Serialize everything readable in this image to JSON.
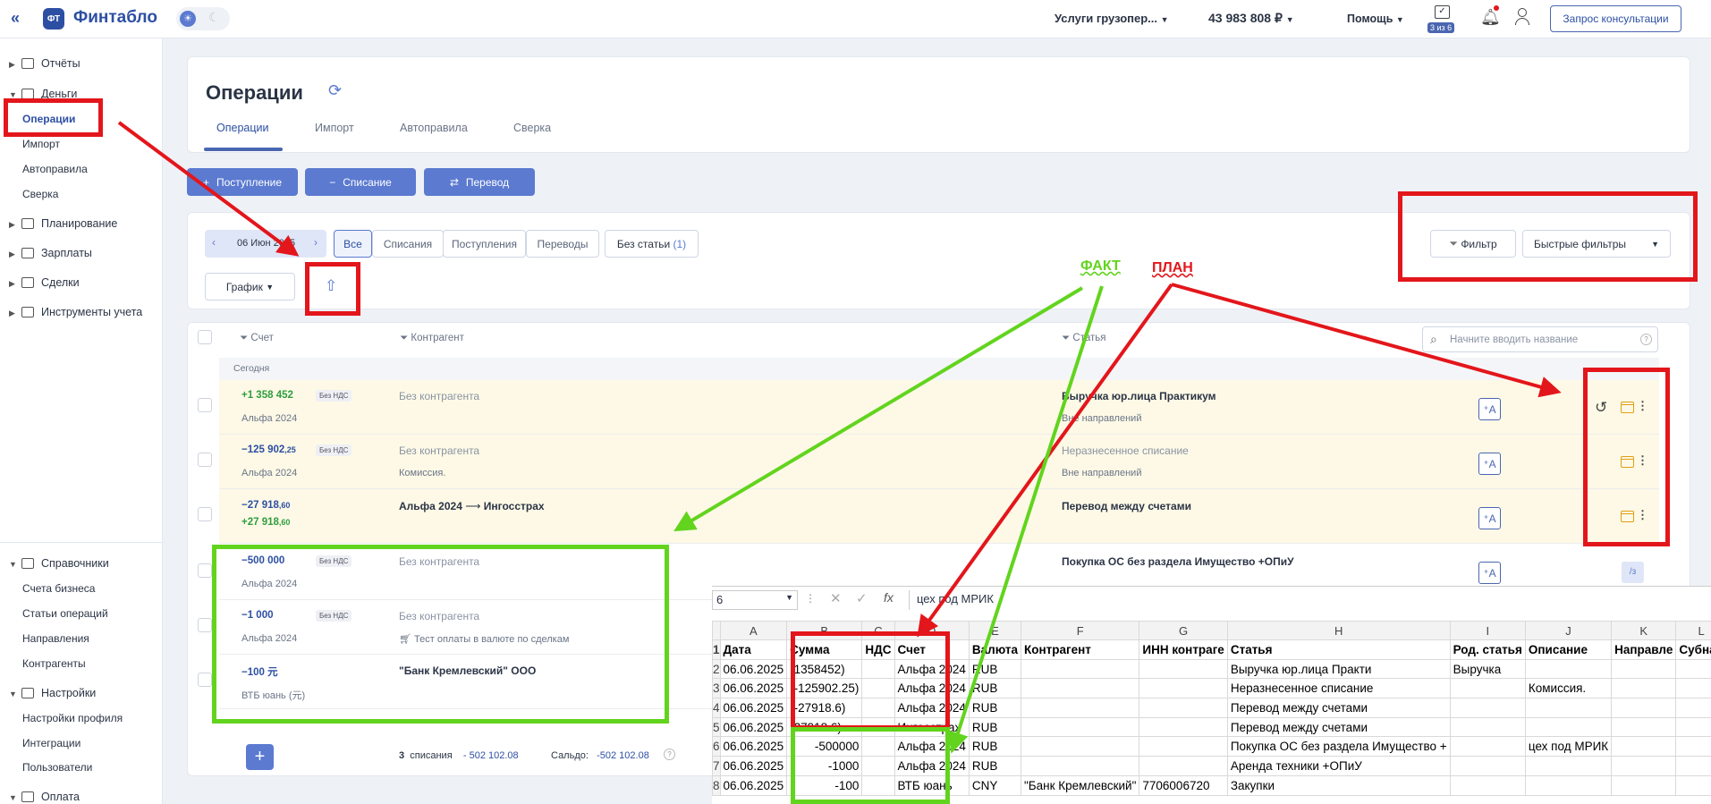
{
  "topbar": {
    "logo_badge": "ФТ",
    "logo_text": "Финтабло",
    "company": "Услуги грузопер...",
    "balance": "43 983 808 ₽",
    "help": "Помощь",
    "tasks_badge": "3 из 6",
    "consult_button": "Запрос консультации"
  },
  "sidebar": {
    "reports": "Отчёты",
    "money": "Деньги",
    "operations": "Операции",
    "import": "Импорт",
    "autorules": "Автоправила",
    "reconciliation": "Сверка",
    "planning": "Планирование",
    "salaries": "Зарплаты",
    "deals": "Сделки",
    "tools": "Инструменты учета",
    "references": "Справочники",
    "business_accounts": "Счета бизнеса",
    "operation_items": "Статьи операций",
    "directions": "Направления",
    "counterparties": "Контрагенты",
    "settings": "Настройки",
    "profile_settings": "Настройки профиля",
    "integrations": "Интеграции",
    "users": "Пользователи",
    "payment": "Оплата"
  },
  "page": {
    "title": "Операции",
    "tabs": [
      "Операции",
      "Импорт",
      "Автоправила",
      "Сверка"
    ]
  },
  "actions": {
    "income": "Поступление",
    "expense": "Списание",
    "transfer": "Перевод"
  },
  "filters": {
    "date": "06 Июн 2025",
    "all": "Все",
    "expenses": "Списания",
    "incomes": "Поступления",
    "transfers": "Переводы",
    "no_item": "Без статьи",
    "no_item_count": "(1)",
    "chart": "График",
    "filter": "Фильтр",
    "quick_filters": "Быстрые фильтры",
    "search_placeholder": "Начните вводить название"
  },
  "table": {
    "col_account": "Счет",
    "col_counterparty": "Контрагент",
    "col_item": "Статья",
    "group_today": "Сегодня",
    "no_vat": "Без НДС",
    "rows": [
      {
        "amount": "+1 358 452",
        "account": "Альфа 2024",
        "counterparty": "Без контрагента",
        "item": "Выручка юр.лица Практикум",
        "item_sub": "Вне направлений"
      },
      {
        "amount": "−125 902",
        "amount_dec": ",25",
        "account": "Альфа 2024",
        "counterparty": "Без контрагента",
        "counterparty_sub": "Комиссия.",
        "item": "Неразнесенное списание",
        "item_sub": "Вне направлений"
      },
      {
        "amount": "−27 918",
        "amount_dec": ",60",
        "amount2": "+27 918",
        "amount2_dec": ",60",
        "from": "Альфа 2024",
        "to": "Ингосстрах",
        "item": "Перевод между счетами"
      },
      {
        "amount": "−500 000",
        "account": "Альфа 2024",
        "counterparty": "Без контрагента",
        "item": "Покупка ОС без раздела Имущество +ОПиУ"
      },
      {
        "amount": "−1 000",
        "account": "Альфа 2024",
        "counterparty": "Без контрагента",
        "counterparty_sub": "Тест оплаты в валюте по сделкам"
      },
      {
        "amount": "−100 元",
        "account": "ВТБ юань (元)",
        "counterparty": "\"Банк Кремлевский\" ООО"
      }
    ],
    "footer_count": "3",
    "footer_label": "списания",
    "footer_sum": "- 502 102.08",
    "footer_saldo_label": "Сальдо:",
    "footer_saldo": "-502 102.08"
  },
  "annotations": {
    "fact": "ФАКТ",
    "plan": "ПЛАН"
  },
  "spreadsheet": {
    "name_box": "6",
    "formula": "цех под МРИК",
    "columns": [
      "A",
      "B",
      "C",
      "D",
      "E",
      "F",
      "G",
      "H",
      "I",
      "J",
      "K",
      "L"
    ],
    "headers": [
      "Дата",
      "Сумма",
      "НДС",
      "Счет",
      "Валюта",
      "Контрагент",
      "ИНН контраге",
      "Статья",
      "Род. статья",
      "Описание",
      "Направле",
      "Субнап"
    ],
    "row_numbers": [
      "1",
      "2",
      "3",
      "4",
      "5",
      "6",
      "7",
      "8"
    ],
    "rows": [
      [
        "06.06.2025",
        "(1358452)",
        "",
        "Альфа 2024",
        "RUB",
        "",
        "",
        "Выручка юр.лица Практи",
        "Выручка",
        "",
        "",
        ""
      ],
      [
        "06.06.2025",
        "(-125902.25)",
        "",
        "Альфа 2024",
        "RUB",
        "",
        "",
        "Неразнесенное списание",
        "",
        "Комиссия.",
        "",
        ""
      ],
      [
        "06.06.2025",
        "(-27918.6)",
        "",
        "Альфа 2024",
        "RUB",
        "",
        "",
        "Перевод между счетами",
        "",
        "",
        "",
        ""
      ],
      [
        "06.06.2025",
        "(27918.6)",
        "",
        "Ингосстрах",
        "RUB",
        "",
        "",
        "Перевод между счетами",
        "",
        "",
        "",
        ""
      ],
      [
        "06.06.2025",
        "-500000",
        "",
        "Альфа 2024",
        "RUB",
        "",
        "",
        "Покупка ОС без раздела Имущество +",
        "",
        "цех под МРИК",
        "",
        ""
      ],
      [
        "06.06.2025",
        "-1000",
        "",
        "Альфа 2024",
        "RUB",
        "",
        "",
        "Аренда техники   +ОПиУ",
        "",
        "",
        "",
        ""
      ],
      [
        "06.06.2025",
        "-100",
        "",
        "ВТБ юань",
        "CNY",
        "\"Банк Кремлевский\"",
        "7706006720",
        "Закупки",
        "",
        "",
        "",
        ""
      ]
    ]
  }
}
